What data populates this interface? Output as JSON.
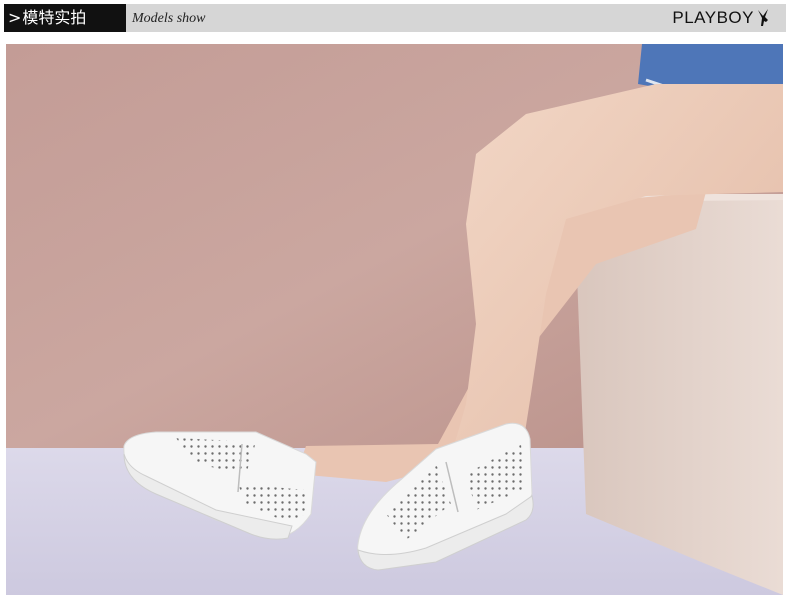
{
  "header": {
    "chevron": ">",
    "title_cn": "模特实拍",
    "subtitle": "Models show",
    "brand": "PLAYBOY",
    "brand_icon": "bunny-logo-icon"
  },
  "colors": {
    "header_bg": "#d6d6d6",
    "tag_bg": "#111111",
    "wall": "#c9a39c",
    "floor": "#d8d5e6",
    "box": "#e4d5ce",
    "shoe": "#f7f7f7",
    "denim": "#4e76b8"
  }
}
